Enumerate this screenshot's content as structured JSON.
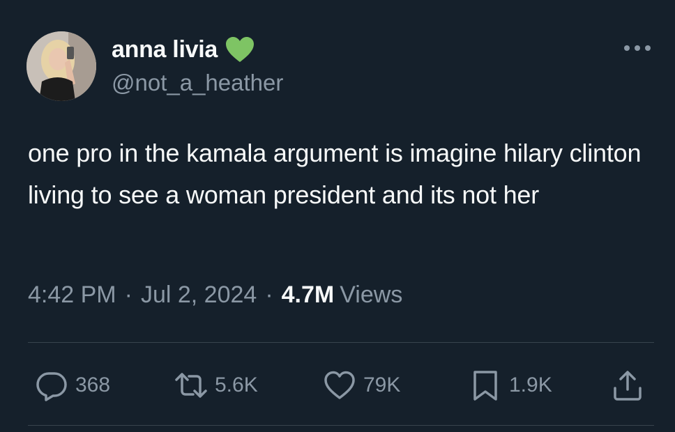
{
  "user": {
    "display_name": "anna livia",
    "handle": "@not_a_heather",
    "badge_icon": "green-heart-icon",
    "badge_color": "#7ec464"
  },
  "tweet": {
    "text": "one pro in the kamala argument is imagine hilary clinton living to see a woman president and its not her",
    "time": "4:42 PM",
    "date": "Jul 2, 2024",
    "views_count": "4.7M",
    "views_label": "Views",
    "separator": "·"
  },
  "actions": {
    "replies": "368",
    "reposts": "5.6K",
    "likes": "79K",
    "bookmarks": "1.9K"
  },
  "colors": {
    "background": "#15202b",
    "text_primary": "#f7f9f9",
    "text_secondary": "#8b98a5",
    "divider": "#38444d"
  }
}
